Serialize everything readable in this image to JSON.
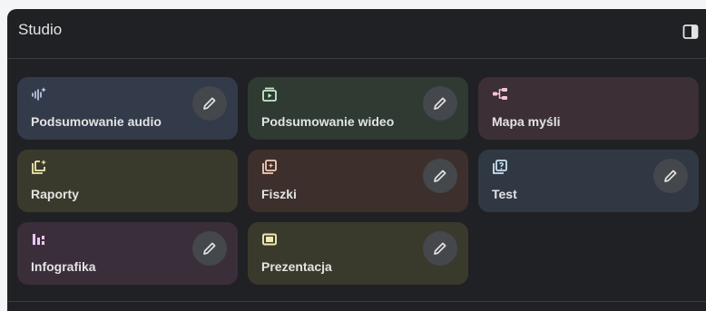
{
  "panel": {
    "title": "Studio",
    "toggle_icon": "side-panel-icon"
  },
  "tiles": [
    {
      "label": "Podsumowanie audio",
      "icon": "audio-waveform-icon",
      "bg": "#333a4a",
      "accent": "#c7d4f5",
      "editable": true
    },
    {
      "label": "Podsumowanie wideo",
      "icon": "video-play-icon",
      "bg": "#2f3a33",
      "accent": "#c8ecc9",
      "editable": true
    },
    {
      "label": "Mapa myśli",
      "icon": "mind-map-icon",
      "bg": "#3c2f36",
      "accent": "#f2c4dc",
      "editable": false
    },
    {
      "label": "Raporty",
      "icon": "report-add-icon",
      "bg": "#3a3a2c",
      "accent": "#f0eab0",
      "editable": false
    },
    {
      "label": "Fiszki",
      "icon": "flashcards-icon",
      "bg": "#3d302c",
      "accent": "#f6c9b8",
      "editable": true
    },
    {
      "label": "Test",
      "icon": "quiz-icon",
      "bg": "#303843",
      "accent": "#cbe0f2",
      "editable": true
    },
    {
      "label": "Infografika",
      "icon": "infographic-chart-icon",
      "bg": "#3b2e3b",
      "accent": "#eac6f5",
      "editable": true
    },
    {
      "label": "Prezentacja",
      "icon": "slides-icon",
      "bg": "#3a3a2c",
      "accent": "#f0eab0",
      "editable": true
    }
  ],
  "colors": {
    "panel_bg": "#202124",
    "text": "#e3e3e3",
    "edit_button_bg": "#44474c"
  }
}
